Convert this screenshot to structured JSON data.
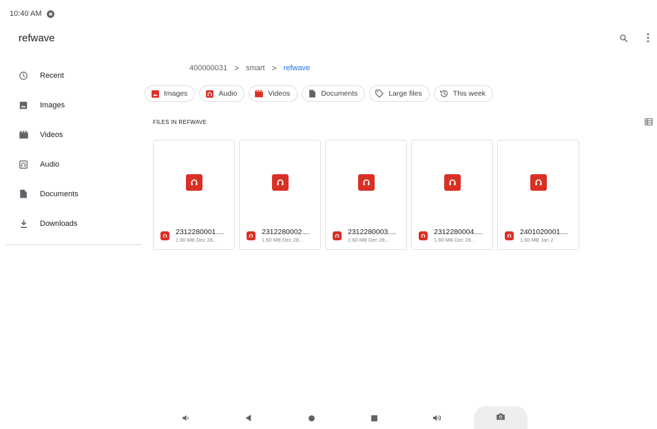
{
  "status_bar": {
    "time": "10:40 AM"
  },
  "app": {
    "title": "refwave"
  },
  "toolbar": {
    "search_icon": "search-icon",
    "more_icon": "more-vert-icon"
  },
  "sidebar": {
    "items": [
      {
        "label": "Recent",
        "icon": "clock-icon"
      },
      {
        "label": "Images",
        "icon": "image-icon"
      },
      {
        "label": "Videos",
        "icon": "movie-icon"
      },
      {
        "label": "Audio",
        "icon": "audio-icon"
      },
      {
        "label": "Documents",
        "icon": "document-icon"
      },
      {
        "label": "Downloads",
        "icon": "download-icon"
      }
    ]
  },
  "breadcrumb": {
    "items": [
      "400000031",
      "smart",
      "refwave"
    ],
    "separator": ">"
  },
  "chips": [
    {
      "label": "Images",
      "icon": "image-icon"
    },
    {
      "label": "Audio",
      "icon": "audio-icon"
    },
    {
      "label": "Videos",
      "icon": "movie-icon"
    },
    {
      "label": "Documents",
      "icon": "document-icon"
    },
    {
      "label": "Large files",
      "icon": "tag-icon"
    },
    {
      "label": "This week",
      "icon": "history-icon"
    }
  ],
  "section": {
    "title": "FILES IN REFWAVE"
  },
  "files": [
    {
      "name": "2312280001....",
      "detail": "1.60 MB Dec 28..."
    },
    {
      "name": "2312280002....",
      "detail": "1.60 MB Dec 28..."
    },
    {
      "name": "2312280003....",
      "detail": "1.60 MB Dec 28..."
    },
    {
      "name": "2312280004....",
      "detail": "1.60 MB Dec 28..."
    },
    {
      "name": "2401020001....",
      "detail": "1.60 MB Jan 2"
    }
  ],
  "colors": {
    "accent": "#1a73e8",
    "audio_red": "#d93025",
    "icon_gray": "#5f6368"
  }
}
